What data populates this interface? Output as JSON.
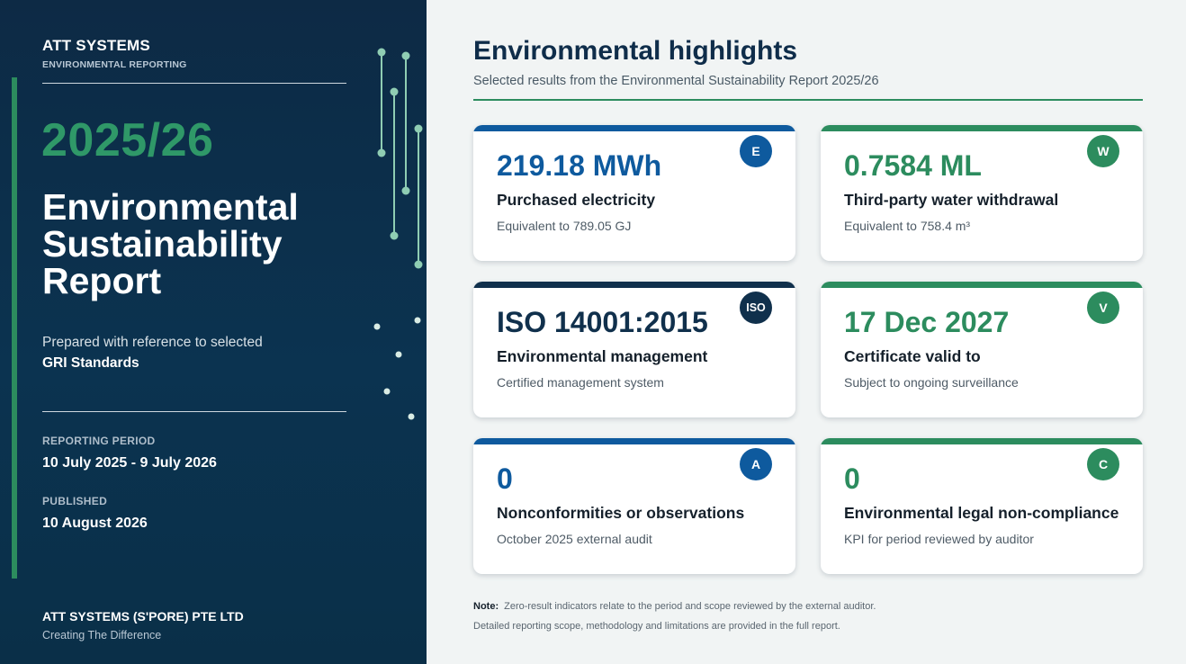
{
  "left": {
    "brand": "ATT SYSTEMS",
    "brand_sub": "ENVIRONMENTAL REPORTING",
    "year": "2025/26",
    "title_lines": [
      "Environmental",
      "Sustainability",
      "Report"
    ],
    "prepared_text": "Prepared with reference to selected",
    "prepared_bold": "GRI Standards",
    "reporting_period_label": "REPORTING PERIOD",
    "reporting_period_value": "10 July 2025 - 9 July 2026",
    "published_label": "PUBLISHED",
    "published_value": "10 August 2026",
    "company": "ATT SYSTEMS (S'PORE) PTE LTD",
    "tagline": "Creating The Difference",
    "colors": {
      "background": "#0d2a45",
      "accent": "#2c8c5e",
      "year": "#2f9868"
    }
  },
  "main": {
    "heading": "Environmental highlights",
    "subheading": "Selected results from the Environmental Sustainability Report 2025/26",
    "cards": [
      {
        "value": "219.18 MWh",
        "label": "Purchased electricity",
        "desc": "Equivalent to 789.05 GJ",
        "badge": "E",
        "color": "#0e5a9e"
      },
      {
        "value": "0.7584 ML",
        "label": "Third-party water withdrawal",
        "desc": "Equivalent to 758.4 m³",
        "badge": "W",
        "color": "#2c8c5e"
      },
      {
        "value": "ISO 14001:2015",
        "label": "Environmental management",
        "desc": "Certified management system",
        "badge": "ISO",
        "color": "#10304c"
      },
      {
        "value": "17 Dec 2027",
        "label": "Certificate valid to",
        "desc": "Subject to ongoing surveillance",
        "badge": "V",
        "color": "#2c8c5e"
      },
      {
        "value": "0",
        "label": "Nonconformities or observations",
        "desc": "October 2025 external audit",
        "badge": "A",
        "color": "#0e5a9e"
      },
      {
        "value": "0",
        "label": "Environmental legal non-compliance",
        "desc": "KPI for period reviewed by auditor",
        "badge": "C",
        "color": "#2c8c5e"
      }
    ],
    "note_label": "Note:",
    "note_text": "Zero-result indicators relate to the period and scope reviewed by the external auditor.",
    "note_text_2": "Detailed reporting scope, methodology and limitations are provided in the full report."
  }
}
